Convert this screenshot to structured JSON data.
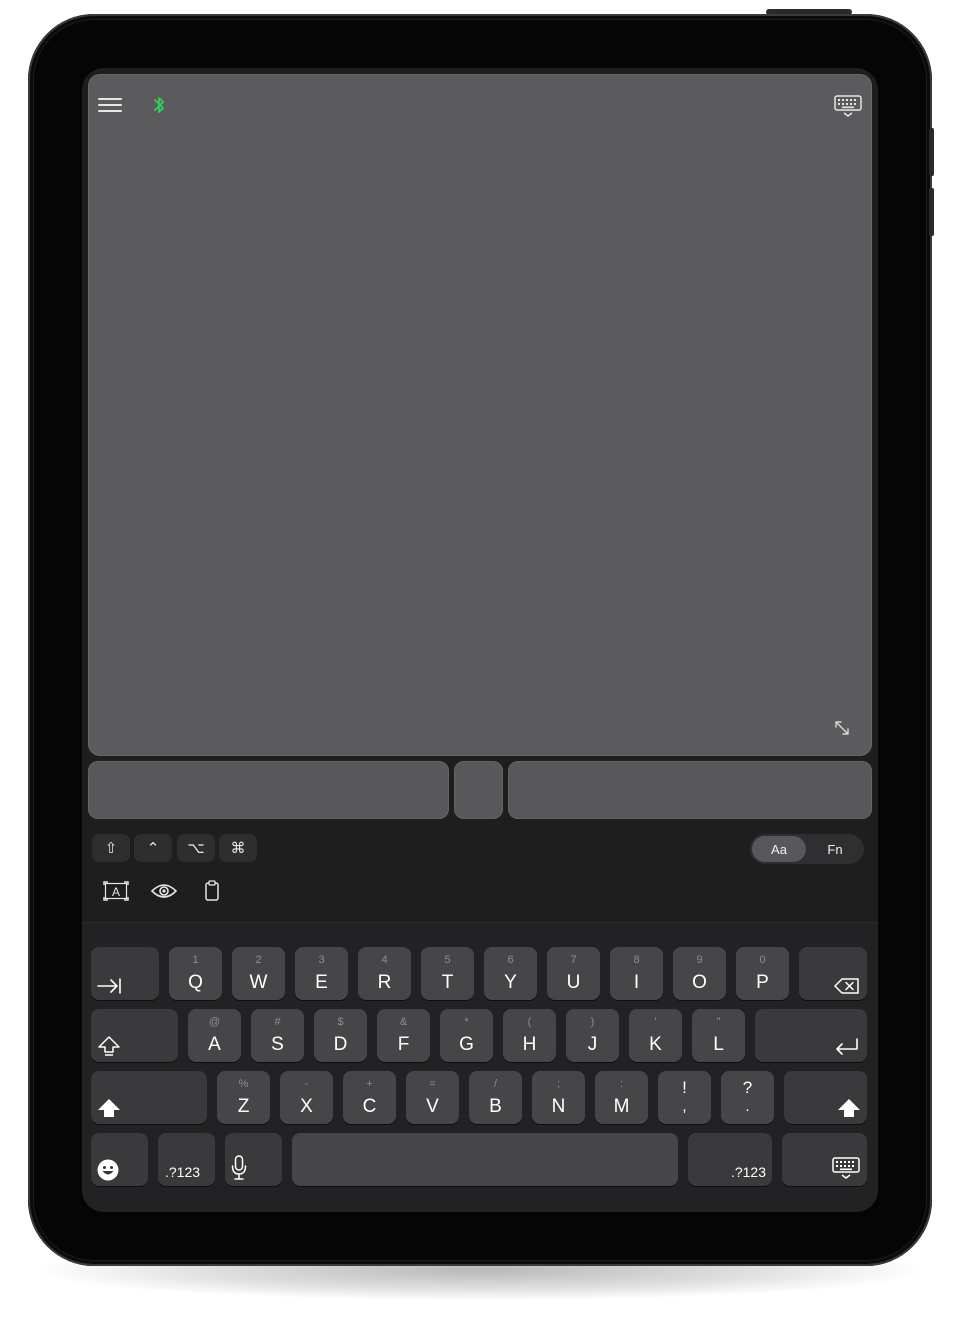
{
  "keyboard": {
    "row1": [
      {
        "sub": "1",
        "main": "Q"
      },
      {
        "sub": "2",
        "main": "W"
      },
      {
        "sub": "3",
        "main": "E"
      },
      {
        "sub": "4",
        "main": "R"
      },
      {
        "sub": "5",
        "main": "T"
      },
      {
        "sub": "6",
        "main": "Y"
      },
      {
        "sub": "7",
        "main": "U"
      },
      {
        "sub": "8",
        "main": "I"
      },
      {
        "sub": "9",
        "main": "O"
      },
      {
        "sub": "0",
        "main": "P"
      }
    ],
    "row2": [
      {
        "sub": "@",
        "main": "A"
      },
      {
        "sub": "#",
        "main": "S"
      },
      {
        "sub": "$",
        "main": "D"
      },
      {
        "sub": "&",
        "main": "F"
      },
      {
        "sub": "*",
        "main": "G"
      },
      {
        "sub": "(",
        "main": "H"
      },
      {
        "sub": ")",
        "main": "J"
      },
      {
        "sub": "'",
        "main": "K"
      },
      {
        "sub": "\"",
        "main": "L"
      }
    ],
    "row3": [
      {
        "sub": "%",
        "main": "Z"
      },
      {
        "sub": "-",
        "main": "X"
      },
      {
        "sub": "+",
        "main": "C"
      },
      {
        "sub": "=",
        "main": "V"
      },
      {
        "sub": "/",
        "main": "B"
      },
      {
        "sub": ";",
        "main": "N"
      },
      {
        "sub": ":",
        "main": "M"
      }
    ],
    "punct": [
      {
        "top": "!",
        "bottom": ","
      },
      {
        "top": "?",
        "bottom": "."
      }
    ],
    "numbers_left_label": ".?123",
    "numbers_right_label": ".?123"
  },
  "modifiers": {
    "shift": "⇧",
    "control": "⌃",
    "option": "⌥",
    "command": "⌘"
  },
  "mode_toggle": {
    "letters": "Aa",
    "function": "Fn",
    "selected": "Aa"
  },
  "icons": {
    "menu": "menu-icon",
    "bluetooth": "bluetooth-icon",
    "keyboard": "keyboard-icon",
    "expand": "expand-icon",
    "text_input": "text-input-icon",
    "eye": "eye-icon",
    "clipboard": "clipboard-icon",
    "tab": "tab-icon",
    "delete": "delete-icon",
    "return": "return-icon",
    "shift": "shift-icon",
    "emoji": "emoji-icon",
    "microphone": "microphone-icon",
    "dismiss_keyboard": "keyboard-dismiss-icon"
  },
  "colors": {
    "bluetooth_connected": "#30d158",
    "trackpad": "#5b5b5e",
    "key": "#464648"
  }
}
